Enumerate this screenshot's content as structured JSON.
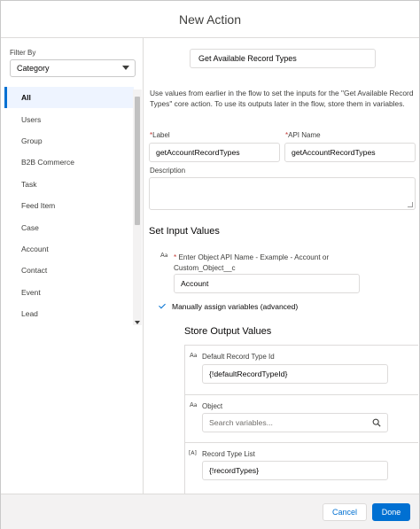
{
  "modal": {
    "title": "New Action"
  },
  "sidebar": {
    "filter_label": "Filter By",
    "filter_value": "Category",
    "items": [
      "All",
      "Users",
      "Group",
      "B2B Commerce",
      "Task",
      "Feed Item",
      "Case",
      "Account",
      "Contact",
      "Event",
      "Lead"
    ],
    "active_item": "All"
  },
  "form": {
    "action_name": "Get Available Record Types",
    "description_text": "Use values from earlier in the flow to set the inputs for the \"Get Available Record Types\" core action. To use its outputs later in the flow, store them in variables.",
    "label": {
      "label": "Label",
      "value": "getAccountRecordTypes"
    },
    "api_name": {
      "label": "API Name",
      "value": "getAccountRecordTypes"
    },
    "description": {
      "label": "Description",
      "value": ""
    },
    "required_marker": "*"
  },
  "inputs": {
    "title": "Set Input Values",
    "object_hint": "Enter Object API Name - Example - Account or Custom_Object__c",
    "object_value": "Account",
    "manual_assign_label": "Manually assign variables (advanced)",
    "manual_assign_checked": true,
    "text_icon": "text-type-icon"
  },
  "outputs": {
    "title": "Store Output Values",
    "default_record_type": {
      "label": "Default Record Type Id",
      "value": "{!defaultRecordTypeId}"
    },
    "object": {
      "label": "Object",
      "placeholder": "Search variables..."
    },
    "record_type_list": {
      "label": "Record Type List",
      "value": "{!recordTypes}"
    }
  },
  "footer": {
    "cancel_label": "Cancel",
    "done_label": "Done"
  },
  "colors": {
    "brand": "#0070d2",
    "border": "#dddbda",
    "active_bg": "#eef4ff",
    "footer_bg": "#f3f2f2"
  }
}
